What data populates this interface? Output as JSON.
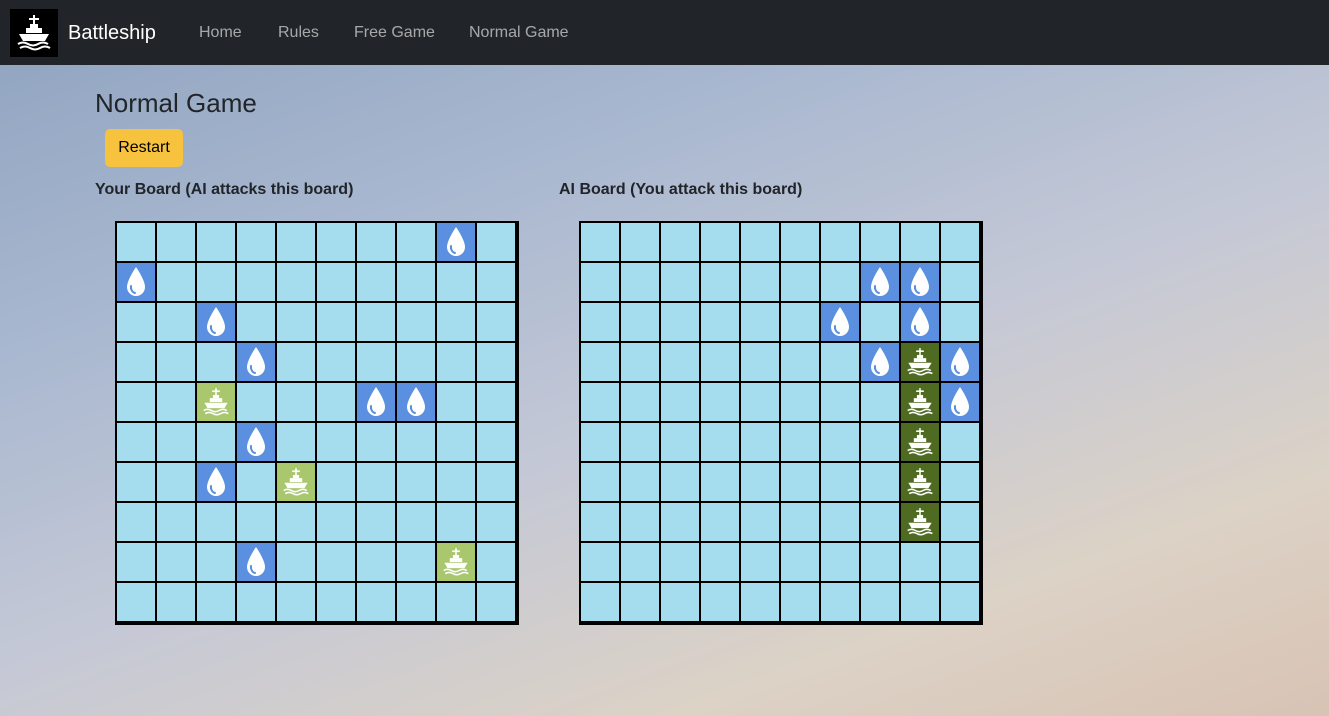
{
  "navbar": {
    "brand": "Battleship",
    "logo_icon": "battleship-icon",
    "links": [
      "Home",
      "Rules",
      "Free Game",
      "Normal Game"
    ]
  },
  "page": {
    "title": "Normal Game",
    "restart_label": "Restart"
  },
  "boards": {
    "player": {
      "label": "Your Board (AI attacks this board)",
      "rows": [
        [
          "",
          "",
          "",
          "",
          "",
          "",
          "",
          "",
          "miss",
          ""
        ],
        [
          "miss",
          "",
          "",
          "",
          "",
          "",
          "",
          "",
          "",
          ""
        ],
        [
          "",
          "",
          "miss",
          "",
          "",
          "",
          "",
          "",
          "",
          ""
        ],
        [
          "",
          "",
          "",
          "miss",
          "",
          "",
          "",
          "",
          "",
          ""
        ],
        [
          "",
          "",
          "hit",
          "",
          "",
          "",
          "miss",
          "miss",
          "",
          ""
        ],
        [
          "",
          "",
          "",
          "miss",
          "",
          "",
          "",
          "",
          "",
          ""
        ],
        [
          "",
          "",
          "miss",
          "",
          "hit",
          "",
          "",
          "",
          "",
          ""
        ],
        [
          "",
          "",
          "",
          "",
          "",
          "",
          "",
          "",
          "",
          ""
        ],
        [
          "",
          "",
          "",
          "miss",
          "",
          "",
          "",
          "",
          "hit",
          ""
        ],
        [
          "",
          "",
          "",
          "",
          "",
          "",
          "",
          "",
          "",
          ""
        ]
      ]
    },
    "ai": {
      "label": "AI Board (You attack this board)",
      "rows": [
        [
          "",
          "",
          "",
          "",
          "",
          "",
          "",
          "",
          "",
          ""
        ],
        [
          "",
          "",
          "",
          "",
          "",
          "",
          "",
          "miss",
          "miss",
          ""
        ],
        [
          "",
          "",
          "",
          "",
          "",
          "",
          "miss",
          "",
          "miss",
          ""
        ],
        [
          "",
          "",
          "",
          "",
          "",
          "",
          "",
          "miss",
          "hit",
          "miss"
        ],
        [
          "",
          "",
          "",
          "",
          "",
          "",
          "",
          "",
          "hit",
          "miss"
        ],
        [
          "",
          "",
          "",
          "",
          "",
          "",
          "",
          "",
          "hit",
          ""
        ],
        [
          "",
          "",
          "",
          "",
          "",
          "",
          "",
          "",
          "hit",
          ""
        ],
        [
          "",
          "",
          "",
          "",
          "",
          "",
          "",
          "",
          "hit",
          ""
        ],
        [
          "",
          "",
          "",
          "",
          "",
          "",
          "",
          "",
          "",
          ""
        ],
        [
          "",
          "",
          "",
          "",
          "",
          "",
          "",
          "",
          "",
          ""
        ]
      ]
    }
  },
  "icons": {
    "miss": "water-drop-icon",
    "hit": "ship-icon"
  },
  "colors": {
    "water": "#a5dcee",
    "miss": "#5b8fe0",
    "player_hit": "#a9c86e",
    "ai_hit": "#4f6b22",
    "restart": "#f7c33e",
    "navbar": "#212529"
  }
}
